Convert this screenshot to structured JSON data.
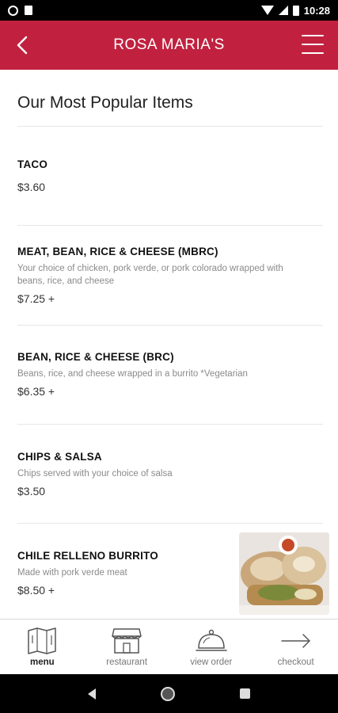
{
  "status_bar": {
    "time": "10:28"
  },
  "header": {
    "title": "ROSA MARIA'S"
  },
  "section": {
    "title": "Our Most Popular Items"
  },
  "items": [
    {
      "name": "TACO",
      "description": "",
      "price": "$3.60"
    },
    {
      "name": "MEAT, BEAN, RICE & CHEESE (MBRC)",
      "description": "Your choice of chicken, pork verde, or pork colorado wrapped with beans, rice, and cheese",
      "price": "$7.25 +"
    },
    {
      "name": "BEAN, RICE & CHEESE (BRC)",
      "description": "Beans, rice, and cheese wrapped in a burrito *Vegetarian",
      "price": "$6.35 +"
    },
    {
      "name": "CHIPS & SALSA",
      "description": "Chips served with your choice of salsa",
      "price": "$3.50"
    },
    {
      "name": "CHILE RELLENO BURRITO",
      "description": "Made with pork verde meat",
      "price": "$8.50 +"
    }
  ],
  "bottom_nav": [
    {
      "label": "menu",
      "icon": "menu-map-icon",
      "active": true
    },
    {
      "label": "restaurant",
      "icon": "storefront-icon",
      "active": false
    },
    {
      "label": "view order",
      "icon": "cloche-icon",
      "active": false
    },
    {
      "label": "checkout",
      "icon": "arrow-right-icon",
      "active": false
    }
  ],
  "colors": {
    "brand": "#c1213f"
  }
}
